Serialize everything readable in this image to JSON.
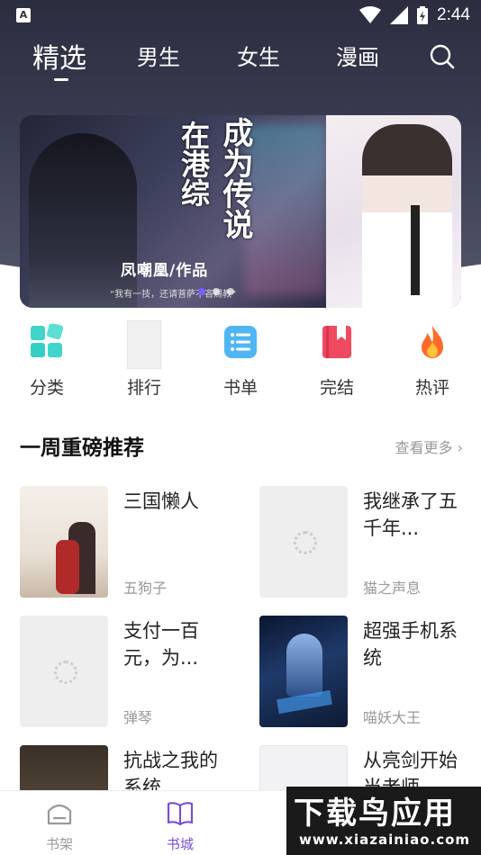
{
  "status_bar": {
    "time": "2:44"
  },
  "top_tabs": [
    {
      "label": "精选",
      "active": true
    },
    {
      "label": "男生",
      "active": false
    },
    {
      "label": "女生",
      "active": false
    },
    {
      "label": "漫画",
      "active": false
    }
  ],
  "banner": {
    "title_col1": "在港综",
    "title_col2": "成为传说",
    "author": "凤嘲凰/作品",
    "quote": "“我有一技，还请菩萨不吝赐教”",
    "dot_count": 3,
    "active_dot": 0
  },
  "categories": [
    {
      "label": "分类",
      "icon": "grid-icon"
    },
    {
      "label": "排行",
      "icon": "ranking-icon"
    },
    {
      "label": "书单",
      "icon": "list-icon"
    },
    {
      "label": "完结",
      "icon": "bookmark-book-icon"
    },
    {
      "label": "热评",
      "icon": "fire-icon"
    }
  ],
  "section": {
    "title": "一周重磅推荐",
    "more": "查看更多"
  },
  "books": [
    {
      "name": "三国懒人",
      "author": "五狗子",
      "cover": "art"
    },
    {
      "name": "我继承了五千年...",
      "author": "猫之声息",
      "cover": "placeholder"
    },
    {
      "name": "支付一百元，为...",
      "author": "弹琴",
      "cover": "placeholder"
    },
    {
      "name": "超强手机系统",
      "author": "喵妖大王",
      "cover": "art"
    },
    {
      "name": "抗战之我的系统",
      "author": "",
      "cover": "art"
    },
    {
      "name": "从亮剑开始当老师",
      "author": "",
      "cover": "art"
    }
  ],
  "bottom_nav": [
    {
      "label": "书架",
      "icon": "bookshelf-icon",
      "active": false
    },
    {
      "label": "书城",
      "icon": "open-book-icon",
      "active": true
    }
  ],
  "watermark": {
    "title": "下载鸟应用",
    "url": "www.xiazainiao.com"
  },
  "colors": {
    "accent": "#7a4fd8",
    "hero": "#2b2d3f"
  }
}
